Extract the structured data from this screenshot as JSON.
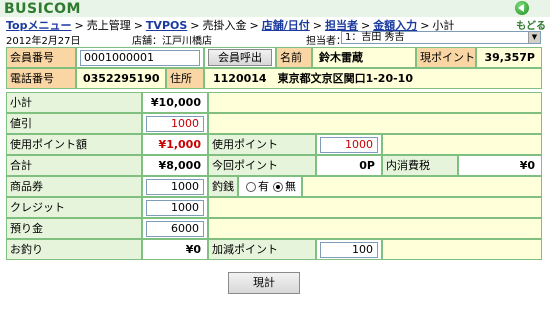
{
  "brand": "BUSICOM",
  "back_label": "もどる",
  "breadcrumb": {
    "top": "Topメニュー",
    "sales": "売上管理",
    "tvpos": "TVPOS",
    "receipt": "売掛入金",
    "store_date": "店舗/日付",
    "staff": "担当者",
    "amount": "金額入力",
    "subtotal": "小計",
    "sep": ">"
  },
  "info": {
    "date": "2012年2月27日",
    "shop": "店舗：江戸川橋店",
    "staff_label": "担当者：",
    "staff_value": "1：吉田 秀吉"
  },
  "member": {
    "number_label": "会員番号",
    "number_value": "0001000001",
    "call_button": "会員呼出",
    "name_label": "名前",
    "name_value": "鈴木雷蔵",
    "points_label": "現ポイント",
    "points_value": "39,357P",
    "phone_label": "電話番号",
    "phone_value": "0352295190",
    "address_label": "住所",
    "address_value": "1120014　東京都文京区関口1-20-10"
  },
  "rows": {
    "subtotal_label": "小計",
    "subtotal_value": "¥10,000",
    "discount_label": "値引",
    "discount_value": "1000",
    "used_points_amount_label": "使用ポイント額",
    "used_points_amount_value": "¥1,000",
    "used_points_label": "使用ポイント",
    "used_points_value": "1000",
    "total_label": "合計",
    "total_value": "¥8,000",
    "this_time_points_label": "今回ポイント",
    "this_time_points_value": "0P",
    "tax_label": "内消費税",
    "tax_value": "¥0",
    "gift_label": "商品券",
    "gift_value": "1000",
    "change_label": "釣銭",
    "change_yes": "有",
    "change_no": "無",
    "credit_label": "クレジット",
    "credit_value": "1000",
    "deposit_label": "預り金",
    "deposit_value": "6000",
    "change_due_label": "お釣り",
    "change_due_value": "¥0",
    "add_points_label": "加減ポイント",
    "add_points_value": "100"
  },
  "cash_button": "現計",
  "colors": {
    "label_orange": "#fad6a5",
    "label_green": "#e6f4dc",
    "value_yellow": "#ffffd9",
    "brand_green": "#2f7a2f",
    "link_blue": "#1a3aa0",
    "alert_red": "#cc0000"
  }
}
